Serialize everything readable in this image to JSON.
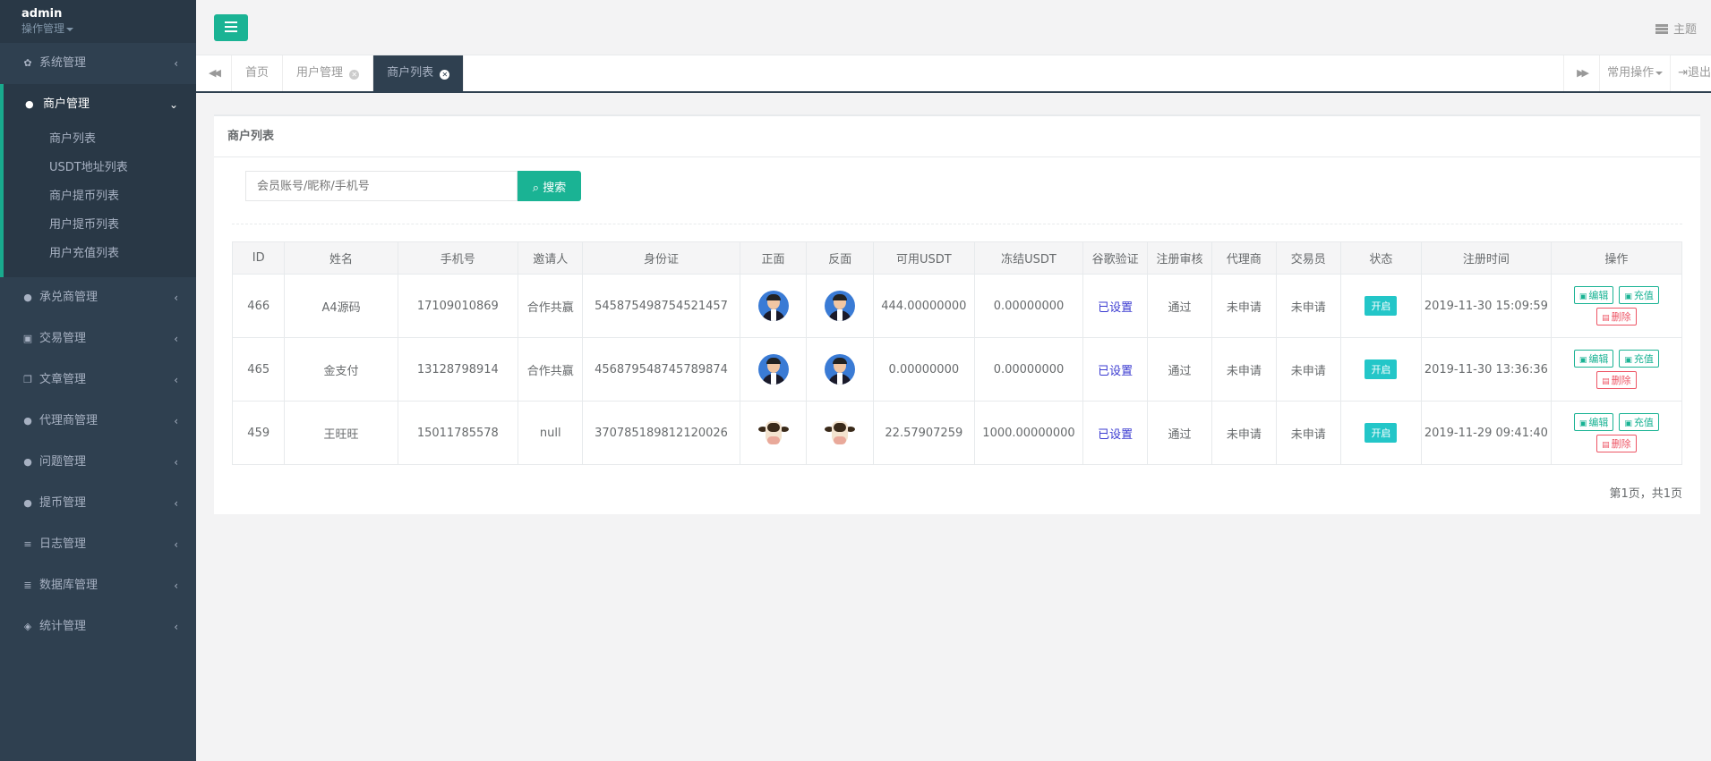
{
  "sidebar": {
    "user": "admin",
    "role": "操作管理",
    "menu_top": {
      "label": "系统管理",
      "icon": "gear-icon"
    },
    "active_menu": {
      "label": "商户管理",
      "icon": "user-icon",
      "items": [
        "商户列表",
        "USDT地址列表",
        "商户提币列表",
        "用户提币列表",
        "用户充值列表"
      ]
    },
    "menu_rest": [
      {
        "label": "承兑商管理",
        "icon": "user-icon"
      },
      {
        "label": "交易管理",
        "icon": "image-icon"
      },
      {
        "label": "文章管理",
        "icon": "copy-icon"
      },
      {
        "label": "代理商管理",
        "icon": "user-icon"
      },
      {
        "label": "问题管理",
        "icon": "comment-icon"
      },
      {
        "label": "提币管理",
        "icon": "user-icon"
      },
      {
        "label": "日志管理",
        "icon": "server-icon"
      },
      {
        "label": "数据库管理",
        "icon": "database-icon"
      },
      {
        "label": "统计管理",
        "icon": "cube-icon"
      }
    ]
  },
  "topbar": {
    "theme_label": "主题"
  },
  "tabs": {
    "items": [
      "首页",
      "用户管理",
      "商户列表"
    ],
    "ops_label": "常用操作",
    "exit_label": "退出"
  },
  "panel": {
    "title": "商户列表",
    "search_placeholder": "会员账号/昵称/手机号",
    "search_button": "搜索",
    "pager": "第1页，共1页"
  },
  "table": {
    "headers": [
      "ID",
      "姓名",
      "手机号",
      "邀请人",
      "身份证",
      "正面",
      "反面",
      "可用USDT",
      "冻结USDT",
      "谷歌验证",
      "注册审核",
      "代理商",
      "交易员",
      "状态",
      "注册时间",
      "操作"
    ],
    "rows": [
      {
        "id": "466",
        "name": "A4源码",
        "phone": "17109010869",
        "inviter": "合作共赢",
        "idcard": "545875498754521457",
        "front": "man-avatar",
        "back": "man-avatar",
        "usdt": "444.00000000",
        "frozen": "0.00000000",
        "google": "已设置",
        "review": "通过",
        "agent": "未申请",
        "trader": "未申请",
        "status": "开启",
        "time": "2019-11-30 15:09:59"
      },
      {
        "id": "465",
        "name": "金支付",
        "phone": "13128798914",
        "inviter": "合作共赢",
        "idcard": "456879548745789874",
        "front": "man-avatar",
        "back": "man-avatar",
        "usdt": "0.00000000",
        "frozen": "0.00000000",
        "google": "已设置",
        "review": "通过",
        "agent": "未申请",
        "trader": "未申请",
        "status": "开启",
        "time": "2019-11-30 13:36:36"
      },
      {
        "id": "459",
        "name": "王旺旺",
        "phone": "15011785578",
        "inviter": "null",
        "idcard": "370785189812120026",
        "front": "cow-image",
        "back": "cow-image",
        "usdt": "22.57907259",
        "frozen": "1000.00000000",
        "google": "已设置",
        "review": "通过",
        "agent": "未申请",
        "trader": "未申请",
        "status": "开启",
        "time": "2019-11-29 09:41:40"
      }
    ],
    "actions": {
      "edit": "编辑",
      "recharge": "充值",
      "delete": "删除"
    }
  },
  "colors": {
    "sidebar": "#2f4050",
    "accent": "#1ab394",
    "status": "#23c6c8",
    "danger": "#ed5565"
  }
}
